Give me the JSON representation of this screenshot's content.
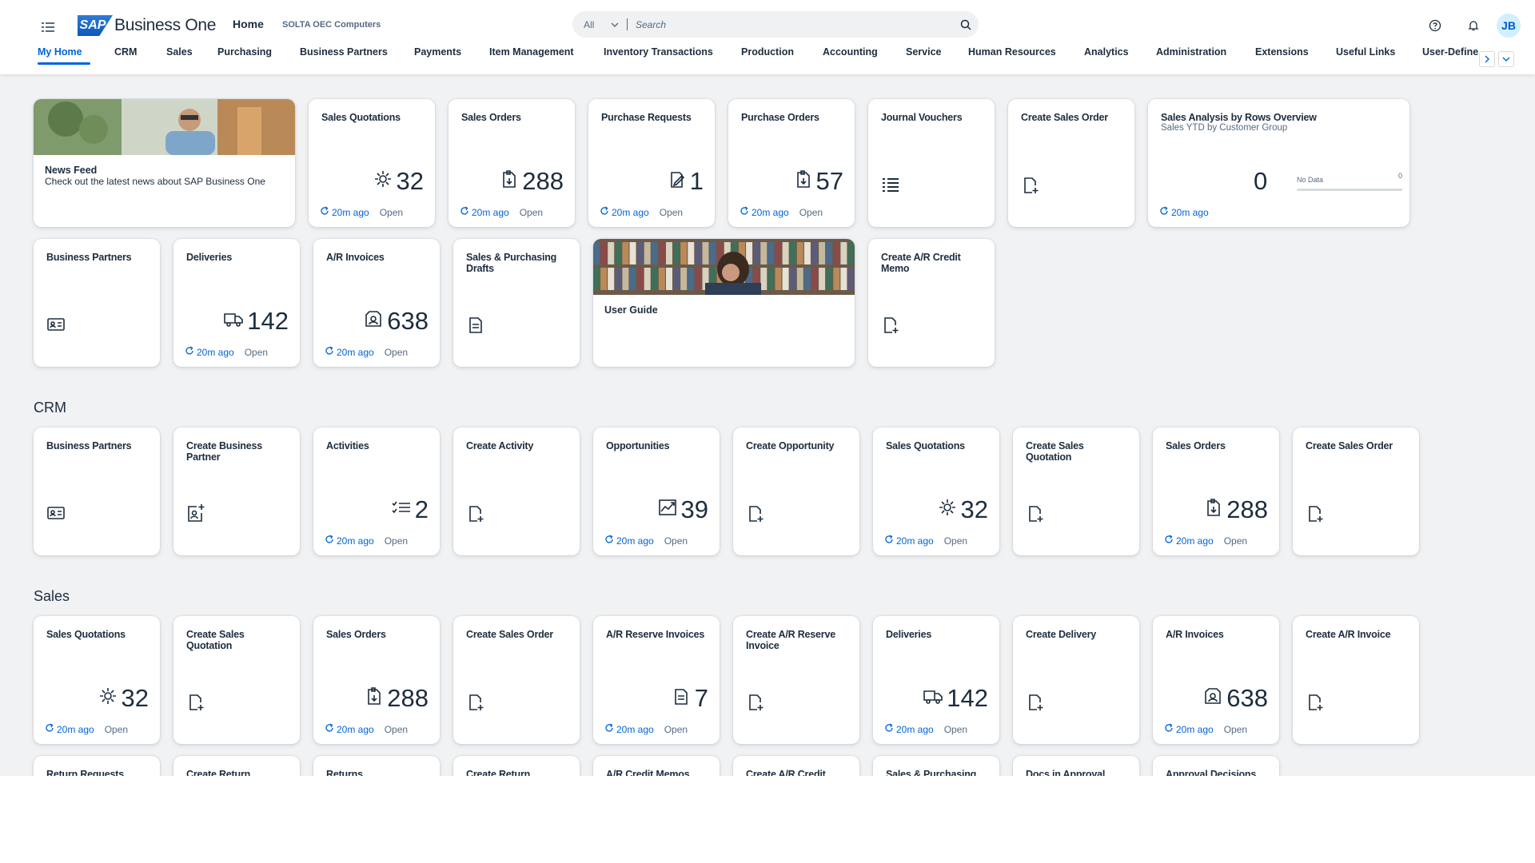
{
  "header": {
    "brand": "Business One",
    "logo_mark": "SAP",
    "home_title": "Home",
    "company": "SOLTA OEC Computers",
    "search": {
      "scope": "All",
      "placeholder": "Search"
    },
    "avatar_initials": "JB",
    "icons": [
      "menu-icon",
      "search-icon",
      "help-icon",
      "bell-icon"
    ]
  },
  "tabs": [
    "My Home",
    "CRM",
    "Sales",
    "Purchasing",
    "Business Partners",
    "Payments",
    "Item Management",
    "Inventory Transactions",
    "Production",
    "Accounting",
    "Service",
    "Human Resources",
    "Analytics",
    "Administration",
    "Extensions",
    "Useful Links",
    "User-Define"
  ],
  "active_tab": "My Home",
  "refresh": "20m ago",
  "status": "Open",
  "myhome": {
    "row1": [
      {
        "type": "image",
        "title": "News Feed",
        "subtitle": "Check out the latest news about SAP Business One"
      },
      {
        "type": "kpi",
        "title": "Sales Quotations",
        "value": "32",
        "icon": "quotation-icon"
      },
      {
        "type": "kpi",
        "title": "Sales Orders",
        "value": "288",
        "icon": "order-icon"
      },
      {
        "type": "kpi",
        "title": "Purchase Requests",
        "value": "1",
        "icon": "request-icon"
      },
      {
        "type": "kpi",
        "title": "Purchase Orders",
        "value": "57",
        "icon": "order-icon"
      },
      {
        "type": "icon",
        "title": "Journal Vouchers",
        "icon": "list-icon"
      },
      {
        "type": "icon",
        "title": "Create Sales Order",
        "icon": "create-document-icon"
      },
      {
        "type": "analysis",
        "title": "Sales Analysis by Rows Overview",
        "subtitle": "Sales YTD by Customer Group",
        "value": "0",
        "nodata_label": "No Data",
        "nodata_value": "0"
      }
    ],
    "row2": [
      {
        "type": "icon",
        "title": "Business Partners",
        "icon": "contact-card-icon"
      },
      {
        "type": "kpi",
        "title": "Deliveries",
        "value": "142",
        "icon": "truck-icon"
      },
      {
        "type": "kpi",
        "title": "A/R Invoices",
        "value": "638",
        "icon": "invoice-icon"
      },
      {
        "type": "icon",
        "title": "Sales & Purchasing Drafts",
        "icon": "draft-document-icon"
      },
      {
        "type": "image",
        "title": "User Guide",
        "subtitle": ""
      },
      {
        "type": "icon",
        "title": "Create A/R Credit Memo",
        "icon": "create-document-icon"
      }
    ]
  },
  "crm": {
    "title": "CRM",
    "tiles": [
      {
        "type": "icon",
        "title": "Business Partners",
        "icon": "contact-card-icon"
      },
      {
        "type": "icon",
        "title": "Create Business Partner",
        "icon": "add-contact-icon"
      },
      {
        "type": "kpi",
        "title": "Activities",
        "value": "2",
        "icon": "checklist-icon"
      },
      {
        "type": "icon",
        "title": "Create Activity",
        "icon": "create-document-icon"
      },
      {
        "type": "kpi",
        "title": "Opportunities",
        "value": "39",
        "icon": "opportunity-icon"
      },
      {
        "type": "icon",
        "title": "Create Opportunity",
        "icon": "create-document-icon"
      },
      {
        "type": "kpi",
        "title": "Sales Quotations",
        "value": "32",
        "icon": "quotation-icon"
      },
      {
        "type": "icon",
        "title": "Create Sales Quotation",
        "icon": "create-document-icon"
      },
      {
        "type": "kpi",
        "title": "Sales Orders",
        "value": "288",
        "icon": "order-icon"
      },
      {
        "type": "icon",
        "title": "Create Sales Order",
        "icon": "create-document-icon"
      }
    ]
  },
  "sales": {
    "title": "Sales",
    "tiles": [
      {
        "type": "kpi",
        "title": "Sales Quotations",
        "value": "32",
        "icon": "quotation-icon"
      },
      {
        "type": "icon",
        "title": "Create Sales Quotation",
        "icon": "create-document-icon"
      },
      {
        "type": "kpi",
        "title": "Sales Orders",
        "value": "288",
        "icon": "order-icon"
      },
      {
        "type": "icon",
        "title": "Create Sales Order",
        "icon": "create-document-icon"
      },
      {
        "type": "kpi",
        "title": "A/R Reserve Invoices",
        "value": "7",
        "icon": "draft-document-icon"
      },
      {
        "type": "icon",
        "title": "Create A/R Reserve Invoice",
        "icon": "create-document-icon"
      },
      {
        "type": "kpi",
        "title": "Deliveries",
        "value": "142",
        "icon": "truck-icon"
      },
      {
        "type": "icon",
        "title": "Create Delivery",
        "icon": "create-document-icon"
      },
      {
        "type": "kpi",
        "title": "A/R Invoices",
        "value": "638",
        "icon": "invoice-icon"
      },
      {
        "type": "icon",
        "title": "Create A/R Invoice",
        "icon": "create-document-icon"
      }
    ],
    "row2": [
      {
        "title": "Return Requests"
      },
      {
        "title": "Create Return"
      },
      {
        "title": "Returns"
      },
      {
        "title": "Create Return"
      },
      {
        "title": "A/R Credit Memos"
      },
      {
        "title": "Create A/R Credit"
      },
      {
        "title": "Sales & Purchasing"
      },
      {
        "title": "Docs in Approval"
      },
      {
        "title": "Approval Decisions"
      }
    ]
  },
  "colors": {
    "accent": "#0064d9",
    "background": "#f1f2f3",
    "text": "#1d2d3e",
    "muted": "#556b82"
  }
}
